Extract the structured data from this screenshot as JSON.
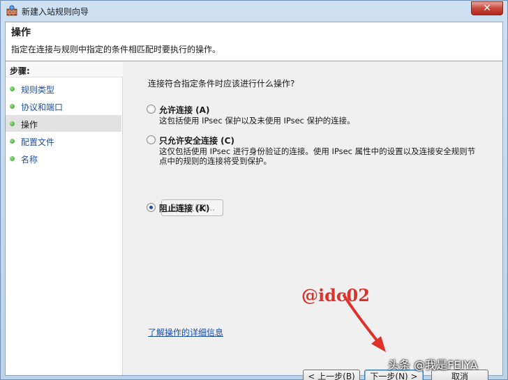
{
  "window": {
    "title": "新建入站规则向导",
    "close_label": "✕"
  },
  "header": {
    "title": "操作",
    "description": "指定在连接与规则中指定的条件相匹配时要执行的操作。"
  },
  "sidebar": {
    "steps_label": "步骤:",
    "items": [
      {
        "label": "规则类型",
        "active": false
      },
      {
        "label": "协议和端口",
        "active": false
      },
      {
        "label": "操作",
        "active": true
      },
      {
        "label": "配置文件",
        "active": false
      },
      {
        "label": "名称",
        "active": false
      }
    ]
  },
  "main": {
    "question": "连接符合指定条件时应该进行什么操作?",
    "options": [
      {
        "label": "允许连接 (A)",
        "desc": "这包括使用 IPsec 保护以及未使用 IPsec 保护的连接。",
        "checked": false
      },
      {
        "label": "只允许安全连接 (C)",
        "desc": "这仅包括使用 IPsec 进行身份验证的连接。使用 IPsec 属性中的设置以及连接安全规则节点中的规则的连接将受到保护。",
        "checked": false
      },
      {
        "label": "阻止连接 (K)",
        "desc": "",
        "checked": true
      }
    ],
    "custom_button": "自定义(Z)...",
    "learn_more": "了解操作的详细信息"
  },
  "footer": {
    "back": "< 上一步(B)",
    "next": "下一步(N) >",
    "cancel": "取消"
  },
  "annotations": {
    "handle": "@idc02",
    "brand": "头条 @我是FEIYA",
    "arrow_color": "#e0302a"
  }
}
